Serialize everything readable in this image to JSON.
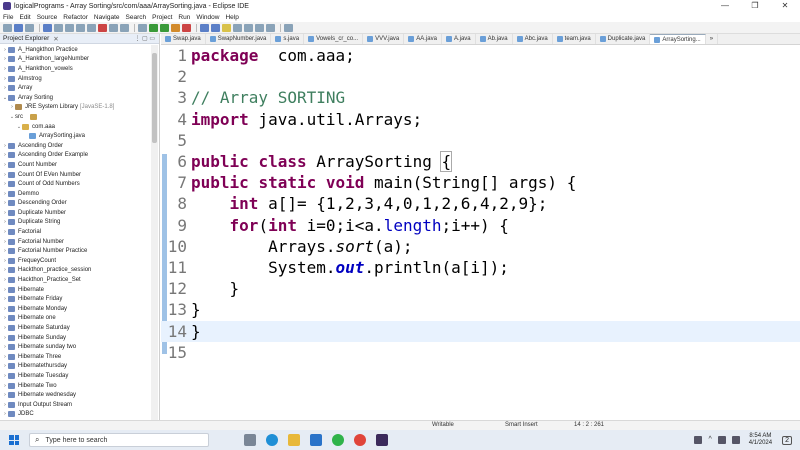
{
  "window": {
    "title": "logicalPrograms - Array Sorting/src/com/aaa/ArraySorting.java - Eclipse IDE",
    "controls": [
      "—",
      "❐",
      "✕"
    ]
  },
  "menu": [
    "File",
    "Edit",
    "Source",
    "Refactor",
    "Navigate",
    "Search",
    "Project",
    "Run",
    "Window",
    "Help"
  ],
  "explorer": {
    "title": "Project Explorer",
    "items": [
      {
        "label": "A_Hangkthon Practice",
        "level": 0,
        "icon": "project-icon"
      },
      {
        "label": "A_Hankthon_largeNumber",
        "level": 0,
        "icon": "project-icon"
      },
      {
        "label": "A_Hankthon_vowels",
        "level": 0,
        "icon": "project-icon"
      },
      {
        "label": "Almstrog",
        "level": 0,
        "icon": "project-icon"
      },
      {
        "label": "Array",
        "level": 0,
        "icon": "project-icon"
      },
      {
        "label": "Array Sorting",
        "level": 0,
        "icon": "project-icon",
        "expanded": true
      },
      {
        "label": "JRE System Library",
        "extra": "[JavaSE-1.8]",
        "level": 1,
        "icon": "library-icon"
      },
      {
        "label": "src",
        "level": 1,
        "icon": "source-folder-icon",
        "expanded": true
      },
      {
        "label": "com.aaa",
        "level": 2,
        "icon": "package-icon",
        "expanded": true
      },
      {
        "label": "ArraySorting.java",
        "level": 3,
        "icon": "java-file-icon"
      },
      {
        "label": "Ascending Order",
        "level": 0,
        "icon": "project-icon"
      },
      {
        "label": "Ascending Order Example",
        "level": 0,
        "icon": "project-icon"
      },
      {
        "label": "Count Number",
        "level": 0,
        "icon": "project-icon"
      },
      {
        "label": "Count Of EVen Number",
        "level": 0,
        "icon": "project-icon"
      },
      {
        "label": "Count of Odd Numbers",
        "level": 0,
        "icon": "project-icon"
      },
      {
        "label": "Demmo",
        "level": 0,
        "icon": "project-icon"
      },
      {
        "label": "Descending Order",
        "level": 0,
        "icon": "project-icon"
      },
      {
        "label": "Duplicate Number",
        "level": 0,
        "icon": "project-icon"
      },
      {
        "label": "Duplicate String",
        "level": 0,
        "icon": "project-icon"
      },
      {
        "label": "Factorial",
        "level": 0,
        "icon": "project-icon"
      },
      {
        "label": "Factorial Number",
        "level": 0,
        "icon": "project-icon"
      },
      {
        "label": "Factorial Number Practice",
        "level": 0,
        "icon": "project-icon"
      },
      {
        "label": "FrequeyCount",
        "level": 0,
        "icon": "project-icon"
      },
      {
        "label": "Hackthon_practice_session",
        "level": 0,
        "icon": "project-icon"
      },
      {
        "label": "Hackthon_Practice_Set",
        "level": 0,
        "icon": "project-icon"
      },
      {
        "label": "Hibernate",
        "level": 0,
        "icon": "project-icon"
      },
      {
        "label": "Hibernate Friday",
        "level": 0,
        "icon": "project-icon"
      },
      {
        "label": "Hibernate Monday",
        "level": 0,
        "icon": "project-icon"
      },
      {
        "label": "Hibernate one",
        "level": 0,
        "icon": "project-icon"
      },
      {
        "label": "Hibernate Saturday",
        "level": 0,
        "icon": "project-icon"
      },
      {
        "label": "Hibernate Sunday",
        "level": 0,
        "icon": "project-icon"
      },
      {
        "label": "Hibernate sunday two",
        "level": 0,
        "icon": "project-icon"
      },
      {
        "label": "Hibernate Three",
        "level": 0,
        "icon": "project-icon"
      },
      {
        "label": "Hibernatethursday",
        "level": 0,
        "icon": "project-icon"
      },
      {
        "label": "Hibernate Tuesday",
        "level": 0,
        "icon": "project-icon"
      },
      {
        "label": "Hibernate Two",
        "level": 0,
        "icon": "project-icon"
      },
      {
        "label": "Hibernate wednesday",
        "level": 0,
        "icon": "project-icon"
      },
      {
        "label": "Input Output Stream",
        "level": 0,
        "icon": "project-icon"
      },
      {
        "label": "JDBC",
        "level": 0,
        "icon": "project-icon"
      }
    ]
  },
  "editor": {
    "tabs": [
      {
        "label": "Swap.java",
        "active": false
      },
      {
        "label": "SwapNumber.java",
        "active": false
      },
      {
        "label": "s.java",
        "active": false
      },
      {
        "label": "Vowels_cr_co...",
        "active": false
      },
      {
        "label": "VVV.java",
        "active": false
      },
      {
        "label": "AA.java",
        "active": false
      },
      {
        "label": "A.java",
        "active": false
      },
      {
        "label": "Ab.java",
        "active": false
      },
      {
        "label": "Abc.java",
        "active": false
      },
      {
        "label": "team.java",
        "active": false
      },
      {
        "label": "Duplicate.java",
        "active": false
      },
      {
        "label": "ArraySorting...",
        "active": true
      }
    ],
    "tabs_more": "»",
    "lines": [
      {
        "n": "1",
        "tokens": [
          [
            "kw",
            "package"
          ],
          [
            "",
            "  com.aaa;"
          ]
        ]
      },
      {
        "n": "2",
        "tokens": []
      },
      {
        "n": "3",
        "tokens": [
          [
            "cm",
            "// Array SORTING"
          ]
        ]
      },
      {
        "n": "4",
        "tokens": [
          [
            "kw",
            "import"
          ],
          [
            "",
            " java.util.Arrays;"
          ]
        ]
      },
      {
        "n": "5",
        "tokens": []
      },
      {
        "n": "6",
        "tokens": [
          [
            "kw",
            "public"
          ],
          [
            "",
            " "
          ],
          [
            "kw",
            "class"
          ],
          [
            "",
            " ArraySorting "
          ],
          [
            "brk",
            "{"
          ]
        ]
      },
      {
        "n": "7",
        "tokens": [
          [
            "kw",
            "public"
          ],
          [
            "",
            " "
          ],
          [
            "kw",
            "static"
          ],
          [
            "",
            " "
          ],
          [
            "kw",
            "void"
          ],
          [
            "",
            " main(String[] args) {"
          ]
        ]
      },
      {
        "n": "8",
        "tokens": [
          [
            "",
            "    "
          ],
          [
            "kw",
            "int"
          ],
          [
            "",
            " a[]= {1,2,3,4,0,1,2,6,4,2,9};"
          ]
        ]
      },
      {
        "n": "9",
        "tokens": [
          [
            "",
            "    "
          ],
          [
            "kw",
            "for"
          ],
          [
            "",
            "("
          ],
          [
            "kw",
            "int"
          ],
          [
            "",
            " i=0;i<a."
          ],
          [
            "fld",
            "length"
          ],
          [
            "",
            ";i++) {"
          ]
        ]
      },
      {
        "n": "10",
        "tokens": [
          [
            "",
            "        Arrays."
          ],
          [
            "it",
            "sort"
          ],
          [
            "",
            "(a);"
          ]
        ]
      },
      {
        "n": "11",
        "tokens": [
          [
            "",
            "        System."
          ],
          [
            "fldit",
            "out"
          ],
          [
            "",
            ".println(a[i]);"
          ]
        ]
      },
      {
        "n": "12",
        "tokens": [
          [
            "",
            "    }"
          ]
        ]
      },
      {
        "n": "13",
        "tokens": [
          [
            "",
            "}"
          ]
        ]
      },
      {
        "n": "14",
        "tokens": [
          [
            "",
            "}"
          ]
        ],
        "current": true
      },
      {
        "n": "15",
        "tokens": []
      }
    ]
  },
  "status": {
    "mode": "Writable",
    "insert": "Smart Insert",
    "position": "14 : 2 : 261"
  },
  "taskbar": {
    "search_placeholder": "Type here to search",
    "time": "8:54 AM",
    "date": "4/1/2024",
    "notif_count": "2"
  }
}
